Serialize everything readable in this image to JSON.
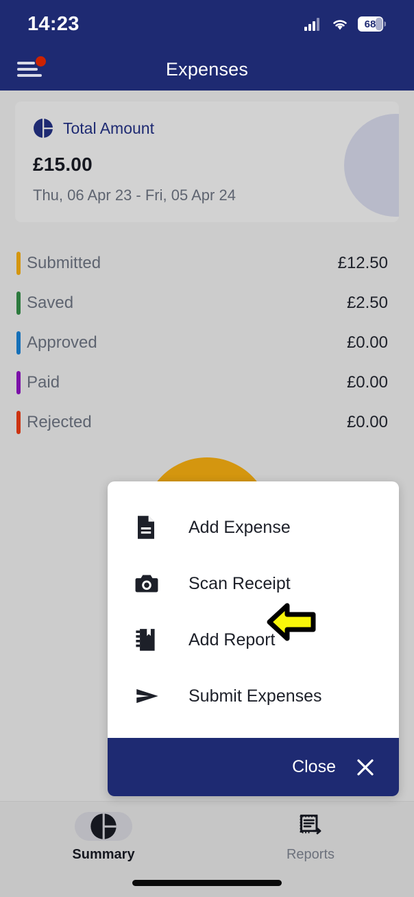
{
  "status_bar": {
    "time": "14:23",
    "battery_level": "68",
    "signal_icon": "cellular-signal-icon",
    "wifi_icon": "wifi-icon",
    "battery_icon": "battery-icon"
  },
  "app_bar": {
    "title": "Expenses",
    "menu_icon": "hamburger-menu-icon",
    "notification_badge": ""
  },
  "total_card": {
    "icon": "pie-chart-icon",
    "title": "Total Amount",
    "amount": "£15.00",
    "date_range": "Thu, 06 Apr 23 -  Fri, 05 Apr 24"
  },
  "status_rows": [
    {
      "label": "Submitted",
      "amount": "£12.50",
      "color": "#d4960f"
    },
    {
      "label": "Saved",
      "amount": "£2.50",
      "color": "#2d7a3e"
    },
    {
      "label": "Approved",
      "amount": "£0.00",
      "color": "#1670b8"
    },
    {
      "label": "Paid",
      "amount": "£0.00",
      "color": "#7b10a8"
    },
    {
      "label": "Rejected",
      "amount": "£0.00",
      "color": "#cc3311"
    }
  ],
  "chart_data": {
    "type": "pie",
    "title": "",
    "categories": [
      "Submitted",
      "Saved"
    ],
    "values": [
      12.5,
      2.5
    ],
    "colors": [
      "#d4960f",
      "#2d7a3e"
    ],
    "legend_position": "above",
    "total": 15.0
  },
  "modal": {
    "items": [
      {
        "label": "Add Expense",
        "icon": "document-icon"
      },
      {
        "label": "Scan Receipt",
        "icon": "camera-icon"
      },
      {
        "label": "Add Report",
        "icon": "notebook-icon"
      },
      {
        "label": "Submit Expenses",
        "icon": "send-icon"
      }
    ],
    "close_label": "Close",
    "close_icon": "close-x-icon",
    "footer_color": "#1e2a72",
    "highlighted_item": "Add Report",
    "cursor_icon": "left-arrow-cursor"
  },
  "bottom_nav": {
    "items": [
      {
        "label": "Summary",
        "icon": "pie-chart-icon",
        "active": true
      },
      {
        "label": "Reports",
        "icon": "receipt-icon",
        "active": false
      }
    ]
  }
}
